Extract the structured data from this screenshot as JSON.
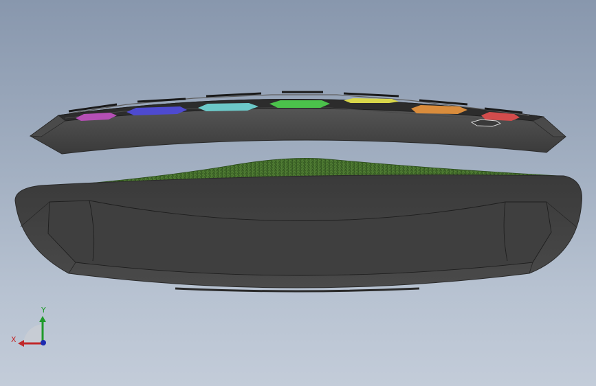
{
  "viewport": {
    "background_top": "#8897ad",
    "background_bottom": "#c3ccd9"
  },
  "model": {
    "lid_color": "#3a3a3a",
    "lid_top_color": "#2e2e2e",
    "tray_color": "#3c3c3c",
    "grass_color": "#3f6a2a",
    "hex_colors": [
      "#b54fb5",
      "#4e4ad0",
      "#6cc8c8",
      "#4bc24b",
      "#d8d64a",
      "#d98c3c",
      "#d24c4c"
    ]
  },
  "triad": {
    "x_label": "X",
    "y_label": "Y",
    "x_color": "#c0282a",
    "y_color": "#1f9a2b",
    "z_color": "#1d2bb0"
  }
}
